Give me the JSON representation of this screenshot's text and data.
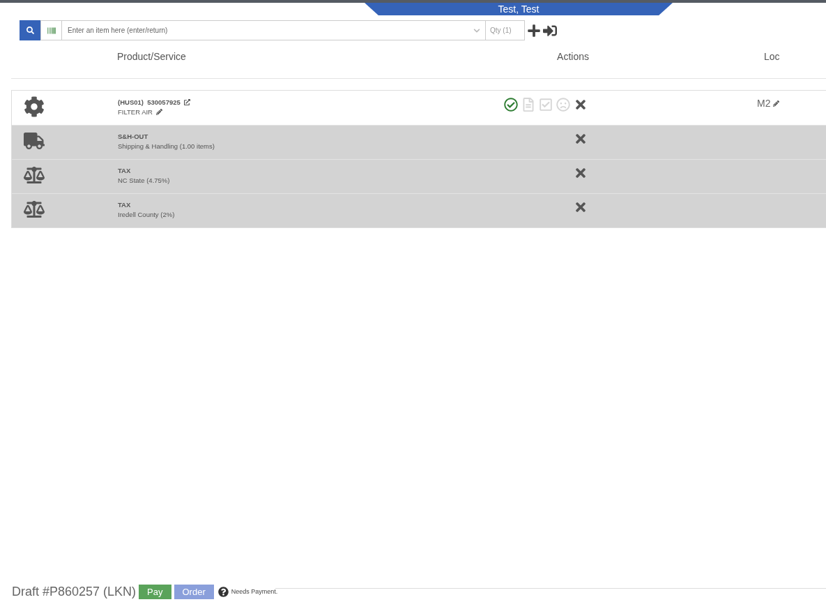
{
  "header_tab": {
    "label": "Test, Test"
  },
  "item_entry": {
    "placeholder": "Enter an item here (enter/return)",
    "qty_placeholder": "Qty (1)"
  },
  "table": {
    "columns": [
      "Product/Service",
      "Actions",
      "Loc"
    ],
    "rows": [
      {
        "kind": "product",
        "title": "(HUS01)  530057925",
        "subtitle": "FILTER AIR",
        "loc": "M2",
        "actions": [
          {
            "kind": "approve",
            "enabled": true
          },
          {
            "kind": "document",
            "enabled": false
          },
          {
            "kind": "checkbox",
            "enabled": false
          },
          {
            "kind": "frown",
            "enabled": false
          },
          {
            "kind": "remove",
            "enabled": true
          }
        ]
      },
      {
        "kind": "shipping",
        "title": "S&H-OUT",
        "subtitle": "Shipping & Handling (1.00 items)",
        "actions": [
          {
            "kind": "remove",
            "enabled": true
          }
        ]
      },
      {
        "kind": "tax",
        "title": "TAX",
        "subtitle": "NC State (4.75%)",
        "actions": [
          {
            "kind": "remove",
            "enabled": true
          }
        ]
      },
      {
        "kind": "tax",
        "title": "TAX",
        "subtitle": "Iredell County (2%)",
        "actions": [
          {
            "kind": "remove",
            "enabled": true
          }
        ]
      }
    ]
  },
  "footer": {
    "draft": "Draft #P860257 (LKN)",
    "buttons": [
      {
        "kind": "pay",
        "label": "Pay"
      },
      {
        "kind": "order",
        "label": "Order"
      }
    ],
    "status": "Needs Payment."
  }
}
